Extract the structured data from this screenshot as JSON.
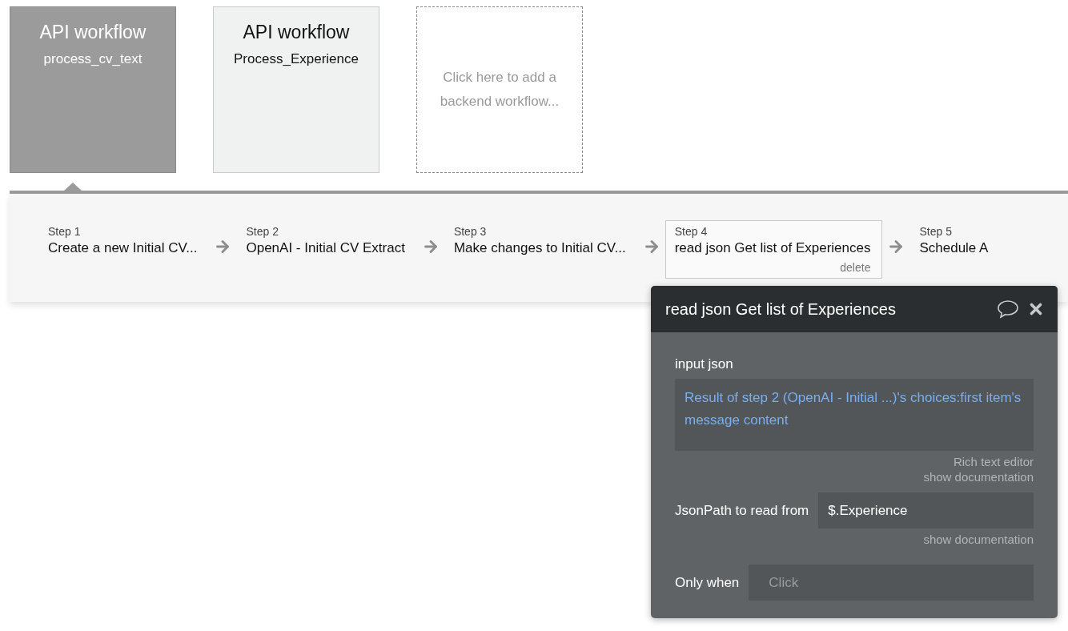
{
  "workflows": [
    {
      "kind": "workflow",
      "title": "API workflow",
      "name": "process_cv_text",
      "selected": true
    },
    {
      "kind": "workflow",
      "title": "API workflow",
      "name": "Process_Experience",
      "selected": false
    },
    {
      "kind": "add",
      "text": "Click here to add a backend workflow..."
    }
  ],
  "steps": [
    {
      "label": "Step 1",
      "title": "Create a new Initial CV...",
      "selected": false
    },
    {
      "label": "Step 2",
      "title": "OpenAI - Initial CV Extract",
      "selected": false
    },
    {
      "label": "Step 3",
      "title": "Make changes to Initial CV...",
      "selected": false
    },
    {
      "label": "Step 4",
      "title": "read json Get list of Experiences",
      "selected": true,
      "action": "delete"
    },
    {
      "label": "Step 5",
      "title": "Schedule A",
      "selected": false
    }
  ],
  "popup": {
    "title": "read json Get list of Experiences",
    "fields": [
      {
        "kind": "rich",
        "label": "input json",
        "value": "Result of step 2 (OpenAI - Initial ...)'s choices:first item's message content",
        "hints": [
          "Rich text editor",
          "show documentation"
        ]
      },
      {
        "kind": "text",
        "label": "JsonPath to read from",
        "value": "$.Experience",
        "hints": [
          "show documentation"
        ]
      },
      {
        "kind": "condition",
        "label": "Only when",
        "placeholder": "Click"
      }
    ]
  }
}
